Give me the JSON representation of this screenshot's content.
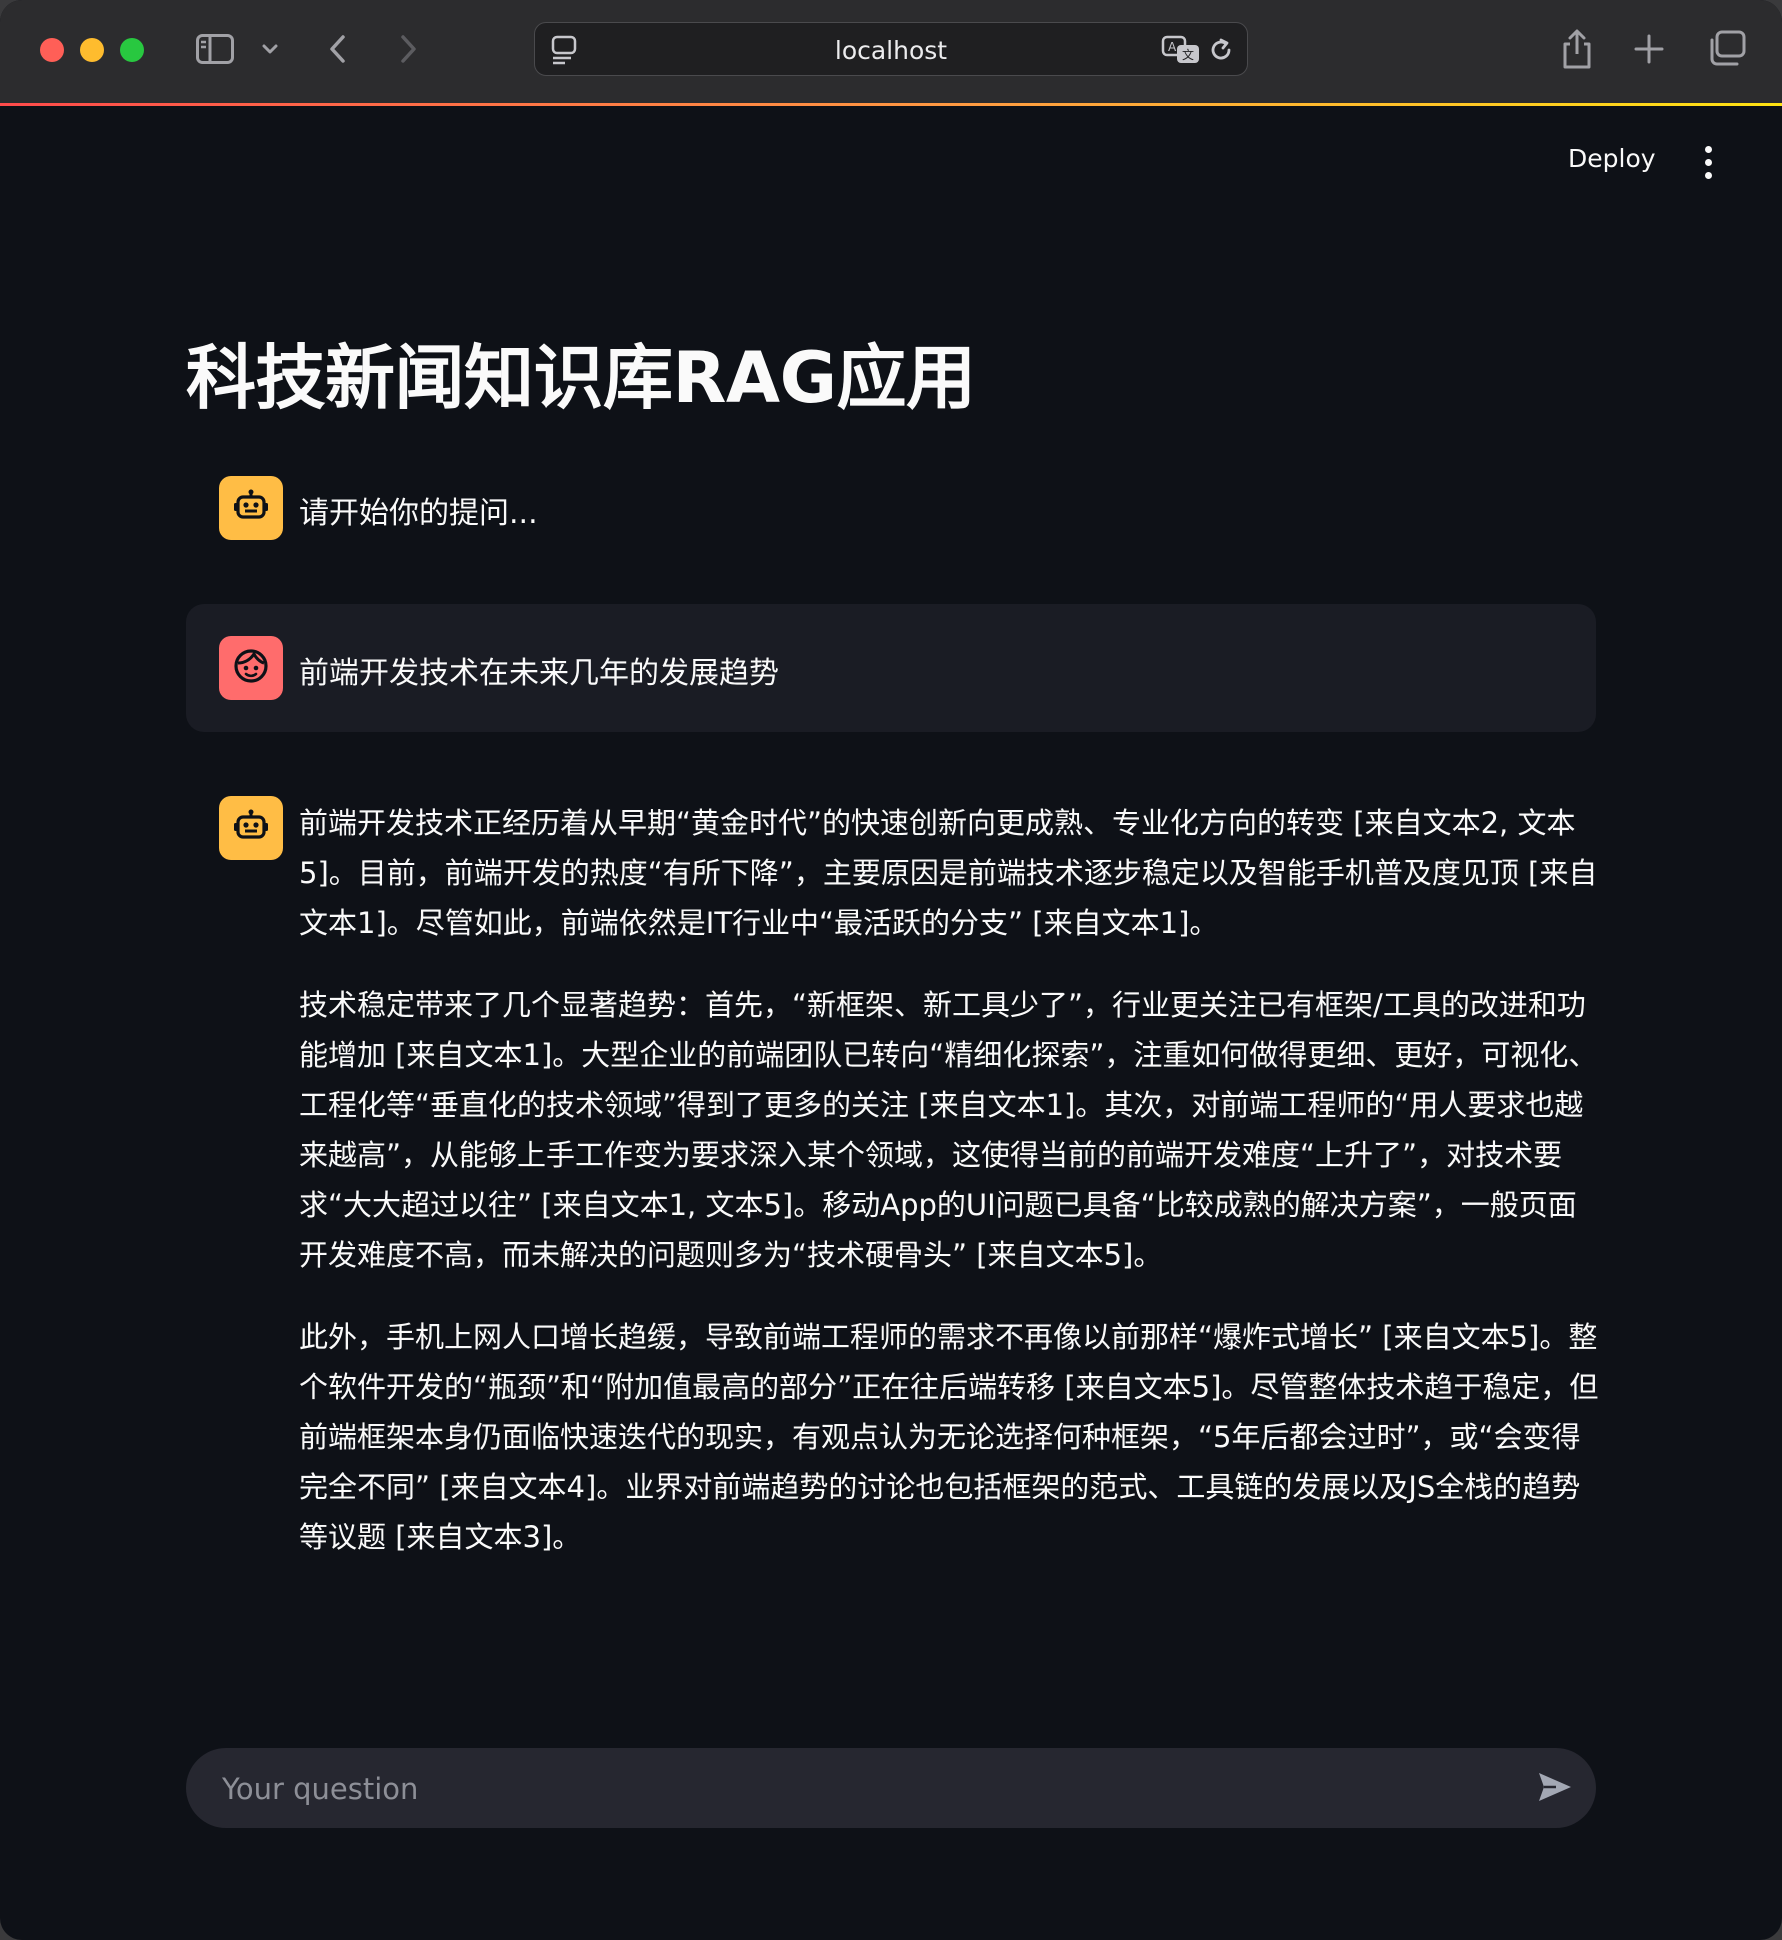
{
  "browser": {
    "address": "localhost",
    "icons": [
      "sidebar-icon",
      "chevron-down-icon",
      "back-icon",
      "forward-icon",
      "page-menu-icon",
      "translate-icon",
      "reload-icon",
      "share-icon",
      "plus-icon",
      "tabs-icon"
    ]
  },
  "header": {
    "deploy_label": "Deploy",
    "menu_icon": "kebab-menu-icon"
  },
  "page": {
    "title": "科技新闻知识库RAG应用"
  },
  "chat": {
    "greeting": "请开始你的提问...",
    "user_question": "前端开发技术在未来几年的发展趋势",
    "answer_paragraphs": [
      "前端开发技术正经历着从早期“黄金时代”的快速创新向更成熟、专业化方向的转变 [来自文本2, 文本5]。目前，前端开发的热度“有所下降”，主要原因是前端技术逐步稳定以及智能手机普及度见顶 [来自文本1]。尽管如此，前端依然是IT行业中“最活跃的分支” [来自文本1]。",
      "技术稳定带来了几个显著趋势：首先，“新框架、新工具少了”，行业更关注已有框架/工具的改进和功能增加 [来自文本1]。大型企业的前端团队已转向“精细化探索”，注重如何做得更细、更好，可视化、工程化等“垂直化的技术领域”得到了更多的关注 [来自文本1]。其次，对前端工程师的“用人要求也越来越高”，从能够上手工作变为要求深入某个领域，这使得当前的前端开发难度“上升了”，对技术要求“大大超过以往” [来自文本1, 文本5]。移动App的UI问题已具备“比较成熟的解决方案”，一般页面开发难度不高，而未解决的问题则多为“技术硬骨头” [来自文本5]。",
      "此外，手机上网人口增长趋缓，导致前端工程师的需求不再像以前那样“爆炸式增长” [来自文本5]。整个软件开发的“瓶颈”和“附加值最高的部分”正在往后端转移 [来自文本5]。尽管整体技术趋于稳定，但前端框架本身仍面临快速迭代的现实，有观点认为无论选择何种框架，“5年后都会过时”，或“会变得完全不同” [来自文本4]。业界对前端趋势的讨论也包括框架的范式、工具链的发展以及JS全栈的趋势等议题 [来自文本3]。"
    ],
    "assistant_icon": "robot-icon",
    "user_icon": "user-face-icon"
  },
  "input": {
    "placeholder": "Your question",
    "value": "",
    "send_icon": "send-icon"
  },
  "colors": {
    "background": "#0e1117",
    "assistant_avatar": "#ffbd45",
    "user_avatar": "#ff6c6c",
    "user_bubble": "#1a1c24",
    "input_bg": "#262730",
    "accent_gradient": [
      "#ff4b4b",
      "#ffe312"
    ]
  }
}
